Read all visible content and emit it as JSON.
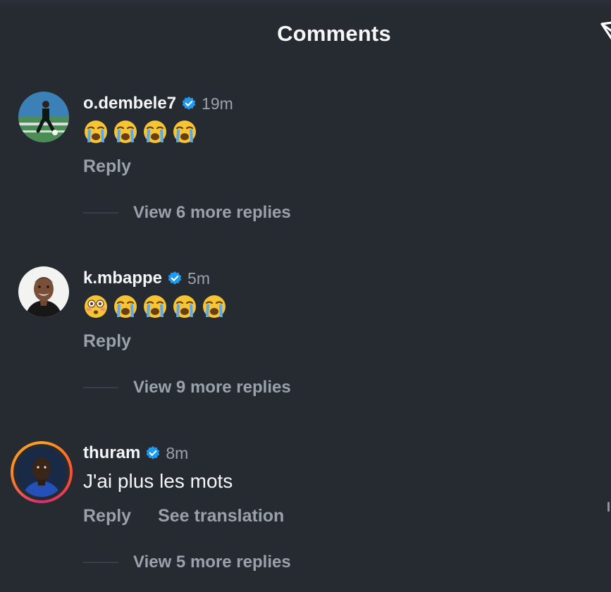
{
  "header": {
    "title": "Comments"
  },
  "comments": [
    {
      "username": "o.dembele7",
      "verified": true,
      "time": "19m",
      "emojis": [
        "loudly-crying-face",
        "loudly-crying-face",
        "loudly-crying-face",
        "loudly-crying-face"
      ],
      "reply_label": "Reply",
      "view_replies": "View 6 more replies"
    },
    {
      "username": "k.mbappe",
      "verified": true,
      "time": "5m",
      "emojis": [
        "flushed-face",
        "loudly-crying-face",
        "loudly-crying-face",
        "loudly-crying-face",
        "loudly-crying-face"
      ],
      "reply_label": "Reply",
      "view_replies": "View 9 more replies"
    },
    {
      "username": "thuram",
      "verified": true,
      "time": "8m",
      "text": "J'ai plus les mots",
      "has_story_ring": true,
      "reply_label": "Reply",
      "translate_label": "See translation",
      "view_replies": "View 5 more replies"
    }
  ],
  "colors": {
    "background": "#262a31",
    "primary_text": "#f4f5f6",
    "secondary_text": "#9aa1aa",
    "verified_blue": "#1d9bf0"
  }
}
